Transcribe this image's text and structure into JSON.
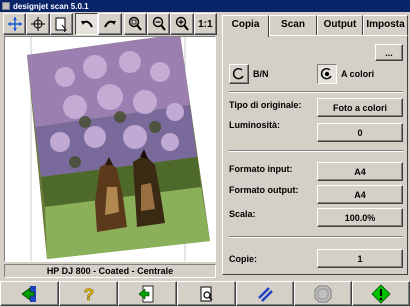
{
  "window": {
    "title": "designjet scan 5.0.1"
  },
  "toolbar": {
    "tools": [
      {
        "icon": "move-cross-icon"
      },
      {
        "icon": "select-cross-icon"
      },
      {
        "icon": "page-select-icon"
      },
      {
        "icon": "rotate-left-icon"
      },
      {
        "icon": "rotate-right-icon"
      },
      {
        "icon": "zoom-fit-icon"
      },
      {
        "icon": "zoom-out-icon"
      },
      {
        "icon": "zoom-in-icon"
      },
      {
        "label": "1:1"
      }
    ]
  },
  "preview": {
    "status": "HP DJ 800 - Coated - Centrale"
  },
  "tabs": [
    {
      "label": "Copia",
      "active": true
    },
    {
      "label": "Scan",
      "active": false
    },
    {
      "label": "Output",
      "active": false
    },
    {
      "label": "Imposta",
      "active": false
    }
  ],
  "copy_panel": {
    "more_button": "...",
    "color_mode": {
      "bw_label": "B/N",
      "color_label": "A colori",
      "selected": "A colori"
    },
    "original_type_label": "Tipo di originale:",
    "original_type_value": "Foto a colori",
    "brightness_label": "Luminosità:",
    "brightness_value": "0",
    "input_size_label": "Formato input:",
    "input_size_value": "A4",
    "output_size_label": "Formato output:",
    "output_size_value": "A4",
    "scale_label": "Scala:",
    "scale_value": "100.0%",
    "copies_label": "Copie:",
    "copies_value": "1"
  },
  "bottom_bar": {
    "buttons": [
      {
        "icon": "exit-door-icon",
        "color": "#00a000"
      },
      {
        "icon": "help-question-icon",
        "color": "#e0c000"
      },
      {
        "icon": "page-arrow-icon",
        "color": "#00a000"
      },
      {
        "icon": "print-preview-icon",
        "color": "#000000"
      },
      {
        "icon": "cancel-slash-icon",
        "color": "#2040c0"
      },
      {
        "icon": "stop-icon",
        "color": "#808080"
      },
      {
        "icon": "start-copy-icon",
        "color": "#00c000"
      }
    ]
  }
}
